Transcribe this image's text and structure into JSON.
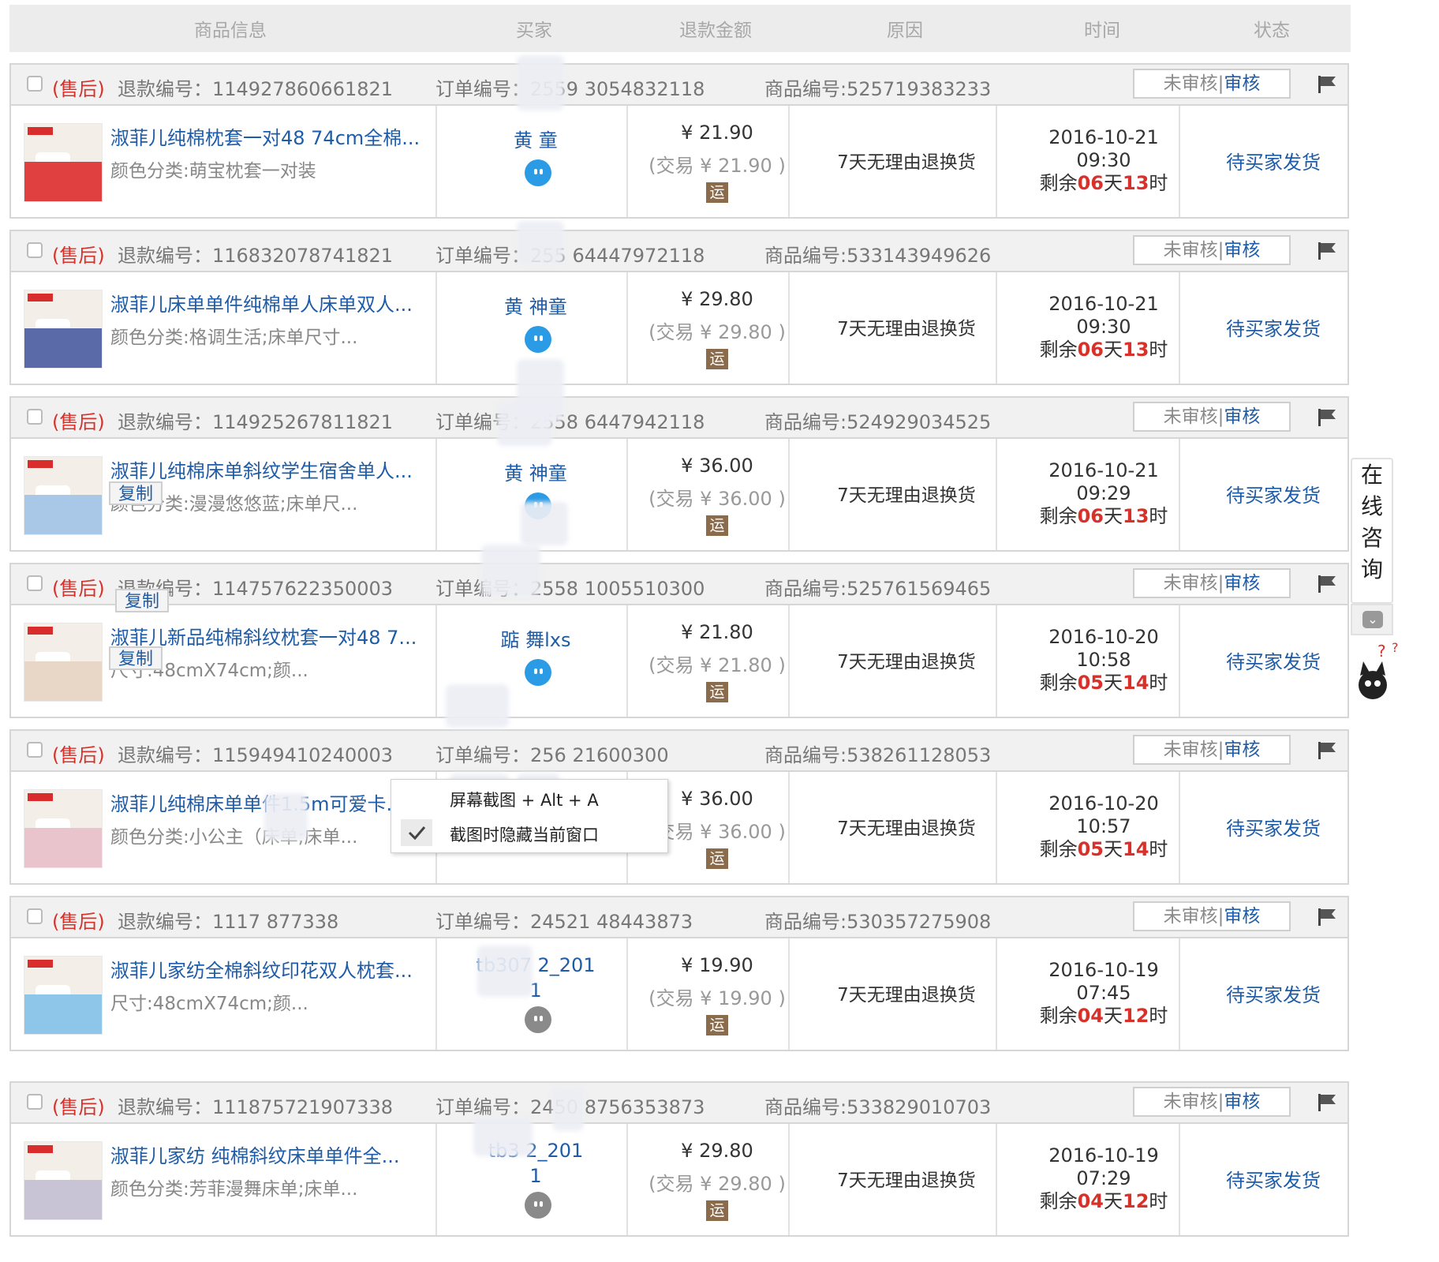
{
  "header": {
    "col_item": "商品信息",
    "col_buyer": "买家",
    "col_amount": "退款金额",
    "col_reason": "原因",
    "col_time": "时间",
    "col_status": "状态"
  },
  "common": {
    "after_sale_tag": "(售后)",
    "refund_prefix": "退款编号：",
    "order_prefix": "订单编号：",
    "item_prefix": "商品编号:",
    "review_unreviewed": "未审核",
    "review_sep": "|",
    "review_link": "审核",
    "trade_prefix": "(交易",
    "trade_suffix": ")",
    "yun": "运",
    "remain_prefix": "剩余",
    "days": "天",
    "hours": "时",
    "reason": "7天无理由退换货",
    "status": "待买家发货",
    "currency": "¥"
  },
  "orders": [
    {
      "refund_no": "114927860661821",
      "order_no": "2559  3054832118",
      "item_no": "525719383233",
      "title": "淑菲儿纯棉枕套一对48 74cm全棉...",
      "sub": "颜色分类:萌宝枕套一对装",
      "buyer": "黄         童",
      "buyer_line2": "",
      "wangwang": "blue",
      "amount": "21.90",
      "trade": "21.90",
      "date": "2016-10-21",
      "clock": "09:30",
      "days_left": "06",
      "hours_left": "13",
      "thumb_color": "#e04040"
    },
    {
      "refund_no": "116832078741821",
      "order_no": "255  64447972118",
      "item_no": "533143949626",
      "title": "淑菲儿床单单件纯棉单人床单双人...",
      "sub": "颜色分类:格调生活;床单尺寸...",
      "buyer": "黄       神童",
      "buyer_line2": "",
      "wangwang": "blue",
      "amount": "29.80",
      "trade": "29.80",
      "date": "2016-10-21",
      "clock": "09:30",
      "days_left": "06",
      "hours_left": "13",
      "thumb_color": "#5a6aa8"
    },
    {
      "refund_no": "114925267811821",
      "order_no": "2558  6447942118",
      "item_no": "524929034525",
      "title": "淑菲儿纯棉床单斜纹学生宿舍单人...",
      "sub": "颜色分类:漫漫悠悠蓝;床单尺...",
      "buyer": "黄       神童",
      "buyer_line2": "",
      "wangwang": "blue",
      "amount": "36.00",
      "trade": "36.00",
      "date": "2016-10-21",
      "clock": "09:29",
      "days_left": "06",
      "hours_left": "13",
      "thumb_color": "#a9c7e6"
    },
    {
      "refund_no": "114757622350003",
      "order_no": "2558  1005510300",
      "item_no": "525761569465",
      "title": "淑菲儿新品纯棉斜纹枕套一对48 7...",
      "sub": "尺寸:48cmX74cm;颜...",
      "buyer": "踮        舞lxs",
      "buyer_line2": "",
      "wangwang": "blue",
      "amount": "21.80",
      "trade": "21.80",
      "date": "2016-10-20",
      "clock": "10:58",
      "days_left": "05",
      "hours_left": "14",
      "thumb_color": "#e8d7c6"
    },
    {
      "refund_no": "115949410240003",
      "order_no": "256   21600300",
      "item_no": "538261128053",
      "title": "淑菲儿纯棉床单单件1.5m可爱卡...",
      "sub": "颜色分类:小公主（床单;床单...",
      "buyer": "",
      "buyer_line2": "",
      "wangwang": "blue",
      "amount": "36.00",
      "trade": "36.00",
      "date": "2016-10-20",
      "clock": "10:57",
      "days_left": "05",
      "hours_left": "14",
      "thumb_color": "#e9c4cc"
    },
    {
      "refund_no": "1117    877338",
      "order_no": "24521   48443873",
      "item_no": "530357275908",
      "title": "淑菲儿家纺全棉斜纹印花双人枕套...",
      "sub": "尺寸:48cmX74cm;颜...",
      "buyer": "tb307    2_201",
      "buyer_line2": "1",
      "wangwang": "gray",
      "amount": "19.90",
      "trade": "19.90",
      "date": "2016-10-19",
      "clock": "07:45",
      "days_left": "04",
      "hours_left": "12",
      "thumb_color": "#8ec6ea"
    },
    {
      "refund_no": "111875721907338",
      "order_no": "2450   8756353873",
      "item_no": "533829010703",
      "title": "淑菲儿家纺 纯棉斜纹床单单件全...",
      "sub": "颜色分类:芳菲漫舞床单;床单...",
      "buyer": "tb3     2_201",
      "buyer_line2": "1",
      "wangwang": "gray",
      "amount": "29.80",
      "trade": "29.80",
      "date": "2016-10-19",
      "clock": "07:29",
      "days_left": "04",
      "hours_left": "12",
      "thumb_color": "#c9c3d6"
    }
  ],
  "copy_tip": "复制",
  "context_menu": {
    "item1": "屏幕截图   + Alt + A",
    "item2": "截图时隐藏当前窗口"
  },
  "side": {
    "chars": [
      "在",
      "线",
      "咨",
      "询"
    ]
  }
}
